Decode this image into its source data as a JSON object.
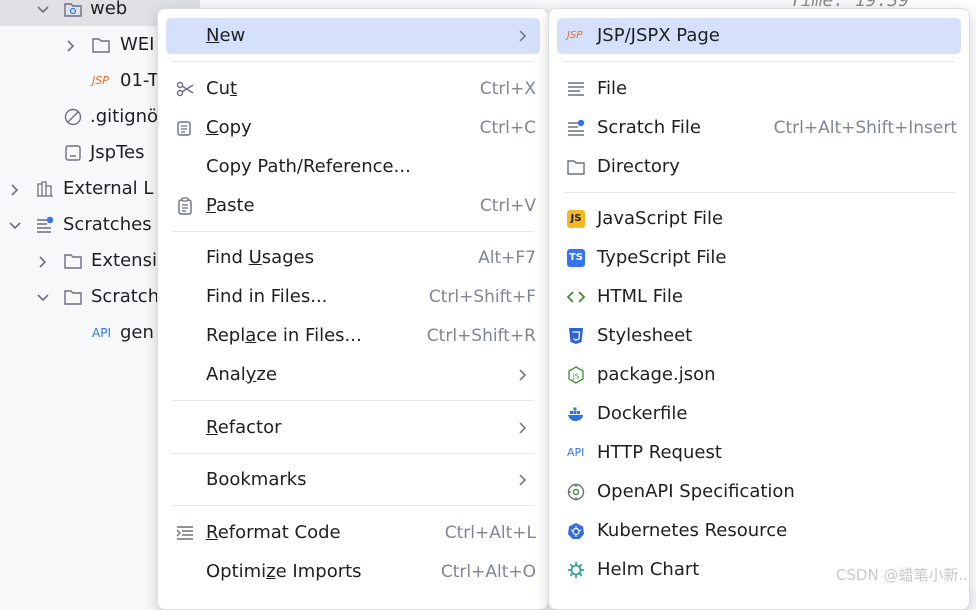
{
  "tree": {
    "items": [
      {
        "label": "web"
      },
      {
        "label": "WEI"
      },
      {
        "label": "01-T"
      },
      {
        "label": ".gitignö"
      },
      {
        "label": "JspTes"
      },
      {
        "label": "External L"
      },
      {
        "label": "Scratches"
      },
      {
        "label": "Extensi"
      },
      {
        "label": "Scratch"
      },
      {
        "label": "gen"
      }
    ]
  },
  "editor": {
    "fragment": "Time: 19:39"
  },
  "context_menu": {
    "new": {
      "pre": "",
      "u": "N",
      "post": "ew"
    },
    "cut": {
      "pre": "Cu",
      "u": "t",
      "post": "",
      "shortcut": "Ctrl+X"
    },
    "copy": {
      "pre": "",
      "u": "C",
      "post": "opy",
      "shortcut": "Ctrl+C"
    },
    "copy_path": {
      "label": "Copy Path/Reference..."
    },
    "paste": {
      "pre": "",
      "u": "P",
      "post": "aste",
      "shortcut": "Ctrl+V"
    },
    "find_usages": {
      "pre": "Find ",
      "u": "U",
      "post": "sages",
      "shortcut": "Alt+F7"
    },
    "find_in_files": {
      "label": "Find in Files...",
      "shortcut": "Ctrl+Shift+F"
    },
    "replace_in_files": {
      "pre": "Repl",
      "u": "a",
      "post": "ce in Files...",
      "shortcut": "Ctrl+Shift+R"
    },
    "analyze": {
      "pre": "Anal",
      "u": "y",
      "post": "ze"
    },
    "refactor": {
      "pre": "",
      "u": "R",
      "post": "efactor"
    },
    "bookmarks": {
      "label": "Bookmarks"
    },
    "reformat_code": {
      "pre": "",
      "u": "R",
      "post": "eformat Code",
      "shortcut": "Ctrl+Alt+L"
    },
    "optimize_imports": {
      "pre": "Optimi",
      "u": "z",
      "post": "e Imports",
      "shortcut": "Ctrl+Alt+O"
    }
  },
  "new_submenu": {
    "jsp": {
      "label": "JSP/JSPX Page",
      "icon_text": "JSP"
    },
    "file": {
      "label": "File"
    },
    "scratch": {
      "label": "Scratch File",
      "shortcut": "Ctrl+Alt+Shift+Insert"
    },
    "directory": {
      "label": "Directory"
    },
    "javascript": {
      "label": "JavaScript File",
      "icon_text": "JS"
    },
    "typescript": {
      "label": "TypeScript File",
      "icon_text": "TS"
    },
    "html": {
      "label": "HTML File"
    },
    "stylesheet": {
      "label": "Stylesheet"
    },
    "package_json": {
      "label": "package.json"
    },
    "dockerfile": {
      "label": "Dockerfile"
    },
    "http_request": {
      "label": "HTTP Request",
      "icon_text": "API"
    },
    "openapi": {
      "label": "OpenAPI Specification"
    },
    "kubernetes": {
      "label": "Kubernetes Resource"
    },
    "helm": {
      "label": "Helm Chart"
    }
  },
  "watermark": "CSDN @蜡笔小新..",
  "colors": {
    "highlight": "#d5e1fb",
    "accent": "#3574f0",
    "jsp": "#e06c2a"
  }
}
